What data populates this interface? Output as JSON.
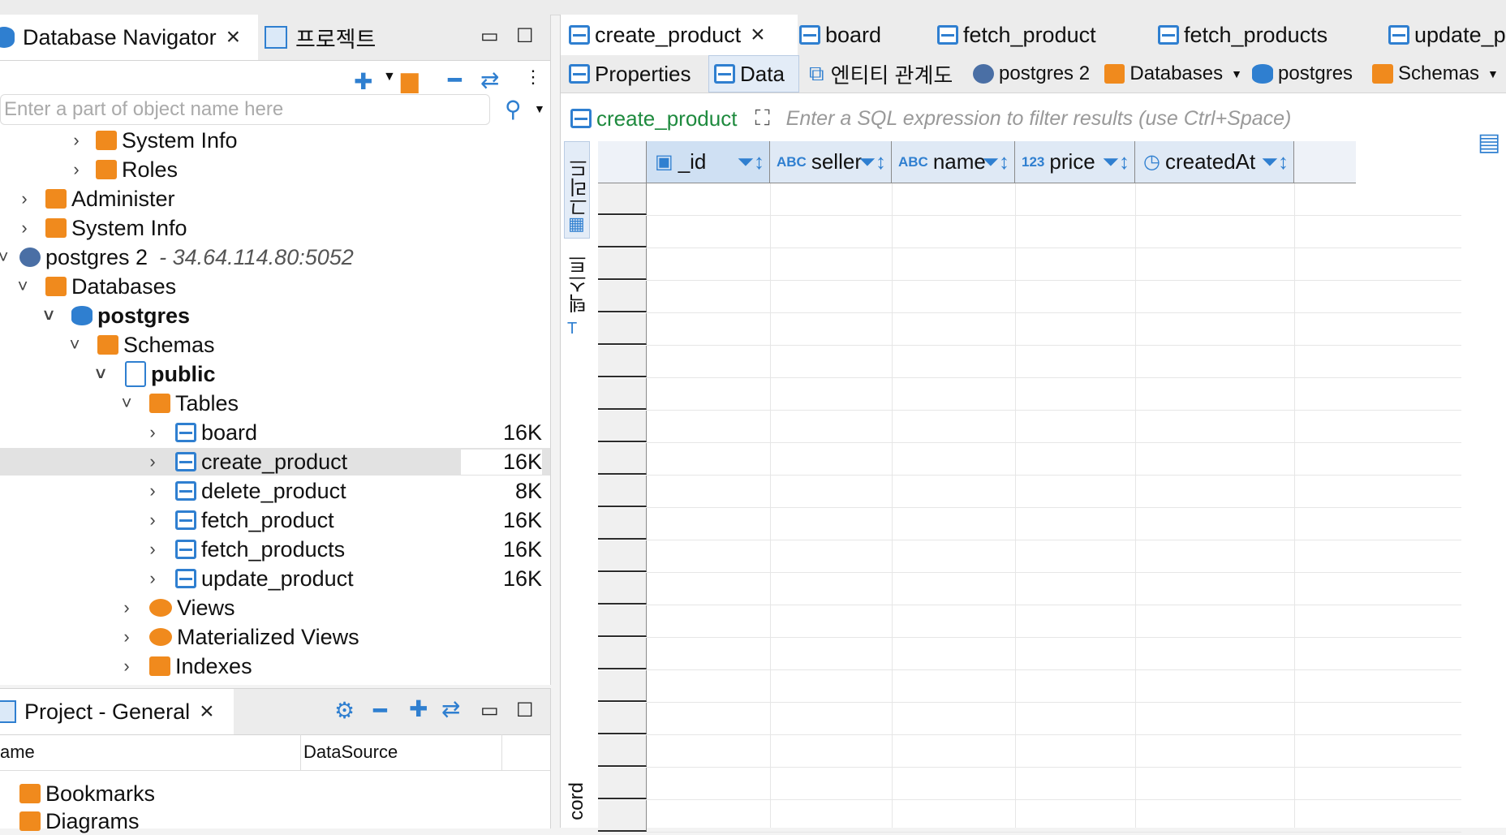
{
  "left_panel": {
    "tabs": [
      {
        "label": "Database Navigator",
        "close": "×"
      },
      {
        "label": "프로젝트"
      }
    ],
    "search_placeholder": "Enter a part of object name here",
    "tree": [
      {
        "label": "System Info",
        "icon": "info-folder-icon"
      },
      {
        "label": "Roles",
        "icon": "roles-folder-icon"
      },
      {
        "label": "Administer",
        "icon": "admin-folder-icon"
      },
      {
        "label": "System Info",
        "icon": "info-folder-icon"
      },
      {
        "label": "postgres 2",
        "host": "- 34.64.114.80:5052",
        "icon": "postgres-icon"
      },
      {
        "label": "Databases",
        "icon": "databases-folder-icon"
      },
      {
        "label": "postgres",
        "icon": "database-icon"
      },
      {
        "label": "Schemas",
        "icon": "schemas-folder-icon"
      },
      {
        "label": "public",
        "icon": "schema-icon"
      },
      {
        "label": "Tables",
        "icon": "tables-folder-icon"
      },
      {
        "label": "board",
        "size": "16K",
        "icon": "table-icon"
      },
      {
        "label": "create_product",
        "size": "16K",
        "icon": "table-icon"
      },
      {
        "label": "delete_product",
        "size": "8K",
        "icon": "table-icon"
      },
      {
        "label": "fetch_product",
        "size": "16K",
        "icon": "table-icon"
      },
      {
        "label": "fetch_products",
        "size": "16K",
        "icon": "table-icon"
      },
      {
        "label": "update_product",
        "size": "16K",
        "icon": "table-icon"
      },
      {
        "label": "Views",
        "icon": "views-icon"
      },
      {
        "label": "Materialized Views",
        "icon": "views-icon"
      },
      {
        "label": "Indexes",
        "icon": "folder-icon"
      }
    ]
  },
  "project_panel": {
    "tab_label": "Project - General",
    "close": "×",
    "columns": [
      "ame",
      "DataSource"
    ],
    "items": [
      {
        "label": "Bookmarks",
        "icon": "bookmarks-folder-icon"
      },
      {
        "label": "Diagrams",
        "icon": "diagrams-folder-icon"
      }
    ]
  },
  "editor": {
    "tabs": [
      {
        "label": "create_product",
        "close": "×"
      },
      {
        "label": "board"
      },
      {
        "label": "fetch_product"
      },
      {
        "label": "fetch_products"
      },
      {
        "label": "update_p"
      }
    ],
    "subtabs": [
      {
        "label": "Properties"
      },
      {
        "label": "Data"
      },
      {
        "label": "엔티티 관계도"
      },
      {
        "label": "postgres 2"
      },
      {
        "label": "Databases"
      },
      {
        "label": "postgres"
      },
      {
        "label": "Schemas"
      }
    ],
    "filter_table": "create_product",
    "filter_placeholder": "Enter a SQL expression to filter results (use Ctrl+Space)",
    "side_labels": {
      "grid": "그리드",
      "text": "텍스트",
      "record": "cord"
    },
    "columns": [
      {
        "type": "",
        "name": "_id"
      },
      {
        "type": "ABC",
        "name": "seller"
      },
      {
        "type": "ABC",
        "name": "name"
      },
      {
        "type": "123",
        "name": "price"
      },
      {
        "type": "",
        "name": "createdAt"
      }
    ]
  }
}
